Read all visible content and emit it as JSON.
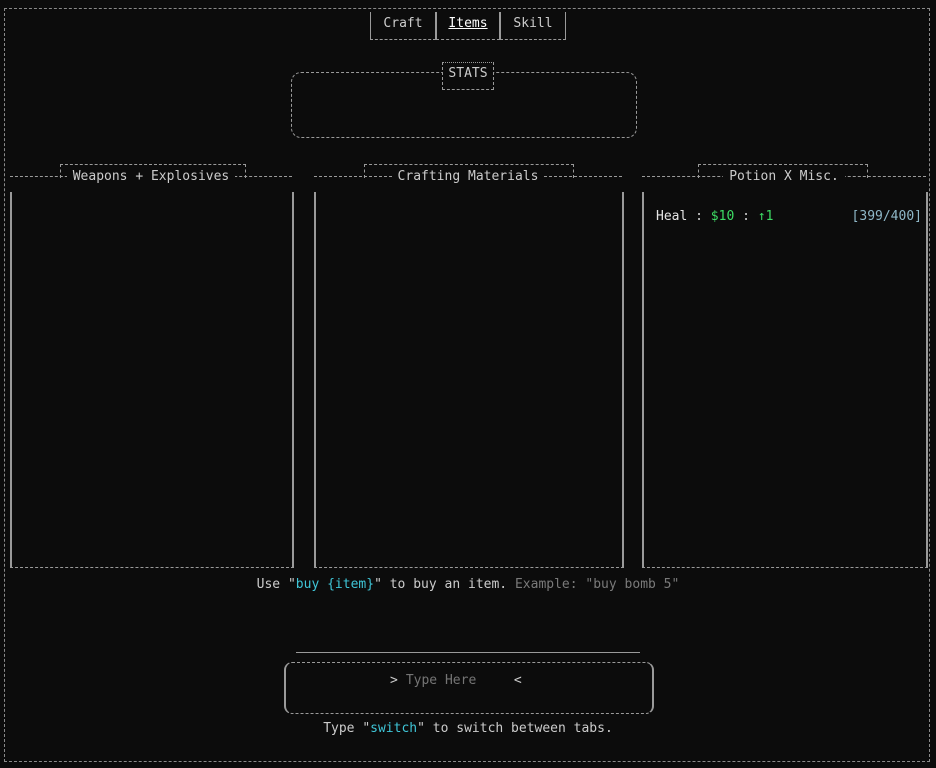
{
  "tabs": [
    {
      "label": "Craft",
      "active": false
    },
    {
      "label": "Items",
      "active": true
    },
    {
      "label": "Skill",
      "active": false
    }
  ],
  "stats": {
    "label": "STATS"
  },
  "panels": {
    "weapons": {
      "title": "Weapons + Explosives"
    },
    "crafting": {
      "title": "Crafting  Materials"
    },
    "potion": {
      "title": "Potion X Misc."
    }
  },
  "potion_items": [
    {
      "name": "Heal",
      "sep1": ":",
      "price": "$10",
      "sep2": ":",
      "level": "↑1",
      "stock": "[399/400]"
    }
  ],
  "help": {
    "pre": "Use \"",
    "command": "buy {item}",
    "post": "\" to buy an item.",
    "example": "Example: \"buy bomb 5\""
  },
  "input": {
    "left_arrow": ">",
    "placeholder": "Type Here",
    "right_arrow": "<"
  },
  "switch_hint": {
    "pre": "Type \"",
    "command": "switch",
    "post": "\" to switch between tabs."
  },
  "colors": {
    "background": "#0c0c0c",
    "text": "#cccccc",
    "accent_cyan": "#3fc6d8",
    "accent_green": "#3ddc64"
  }
}
